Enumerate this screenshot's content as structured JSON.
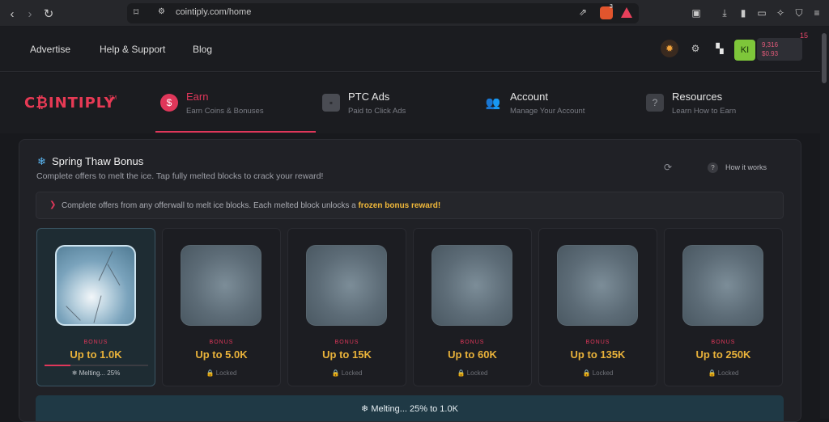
{
  "browser": {
    "url": "cointiply.com/home",
    "shield_count": "3"
  },
  "site_header": {
    "links": [
      "Advertise",
      "Help & Support",
      "Blog"
    ],
    "avatar_initials": "KI",
    "balance_coins": "9,316",
    "balance_usd": "$0.93",
    "notification_count": "15"
  },
  "logo": {
    "text": "C₿INTIPLY",
    "tm": "TM"
  },
  "nav": [
    {
      "title": "Earn",
      "subtitle": "Earn Coins & Bonuses",
      "icon": "dollar-icon",
      "active": true
    },
    {
      "title": "PTC Ads",
      "subtitle": "Paid to Click Ads",
      "icon": "ad-icon",
      "active": false
    },
    {
      "title": "Account",
      "subtitle": "Manage Your Account",
      "icon": "users-icon",
      "active": false
    },
    {
      "title": "Resources",
      "subtitle": "Learn How to Earn",
      "icon": "question-chat-icon",
      "active": false
    }
  ],
  "panel": {
    "title": "Spring Thaw Bonus",
    "subtitle": "Complete offers to melt the ice. Tap fully melted blocks to crack your reward!",
    "how_it_works": "How it works",
    "info_text": "Complete offers from any offerwall to melt ice blocks. Each melted block unlocks a",
    "info_highlight": "frozen bonus reward!",
    "cards": [
      {
        "label": "BONUS",
        "amount": "Up to 1.0K",
        "status": "❄ Melting... 25%",
        "progress": 0.25
      },
      {
        "label": "BONUS",
        "amount": "Up to 5.0K",
        "status": "Locked"
      },
      {
        "label": "BONUS",
        "amount": "Up to 15K",
        "status": "Locked"
      },
      {
        "label": "BONUS",
        "amount": "Up to 60K",
        "status": "Locked"
      },
      {
        "label": "BONUS",
        "amount": "Up to 135K",
        "status": "Locked"
      },
      {
        "label": "BONUS",
        "amount": "Up to 250K",
        "status": "Locked"
      }
    ],
    "footer_text": "❄ Melting... 25% to 1.0K"
  },
  "colors": {
    "accent": "#e0375a",
    "gold": "#e9b23a",
    "ice_blue": "#5ab6f2"
  }
}
